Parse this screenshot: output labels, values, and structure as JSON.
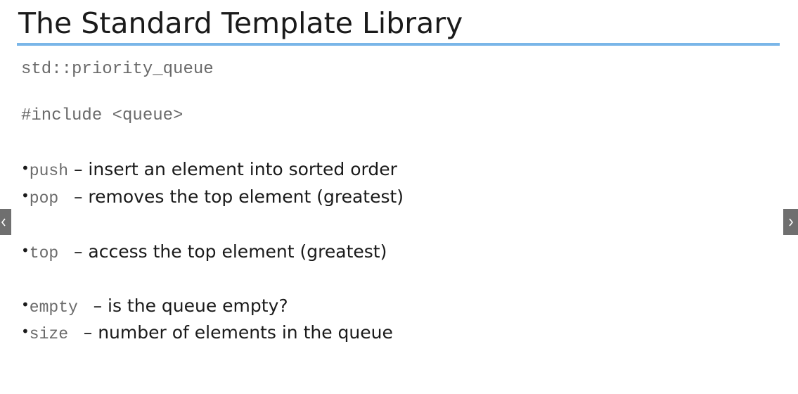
{
  "slide": {
    "title": "The Standard Template Library",
    "class_name": "std::priority_queue",
    "include": "#include <queue>",
    "bullet_glyph": "•",
    "methods": [
      {
        "name": "push",
        "desc": " – insert an element into sorted order"
      },
      {
        "name": "pop ",
        "desc": " – removes the top element (greatest)"
      },
      {
        "name": "top ",
        "desc": " – access the top element (greatest)"
      },
      {
        "name": "empty ",
        "desc": " – is the queue empty?"
      },
      {
        "name": "size ",
        "desc": " – number of elements in the queue"
      }
    ]
  },
  "nav": {
    "prev_icon": "chevron-left-icon",
    "next_icon": "chevron-right-icon",
    "color": "#6f6f6f"
  },
  "colors": {
    "title_rule": "#7ab6e8",
    "code_text": "#6a6a6a",
    "body_text": "#1a1a1a"
  }
}
